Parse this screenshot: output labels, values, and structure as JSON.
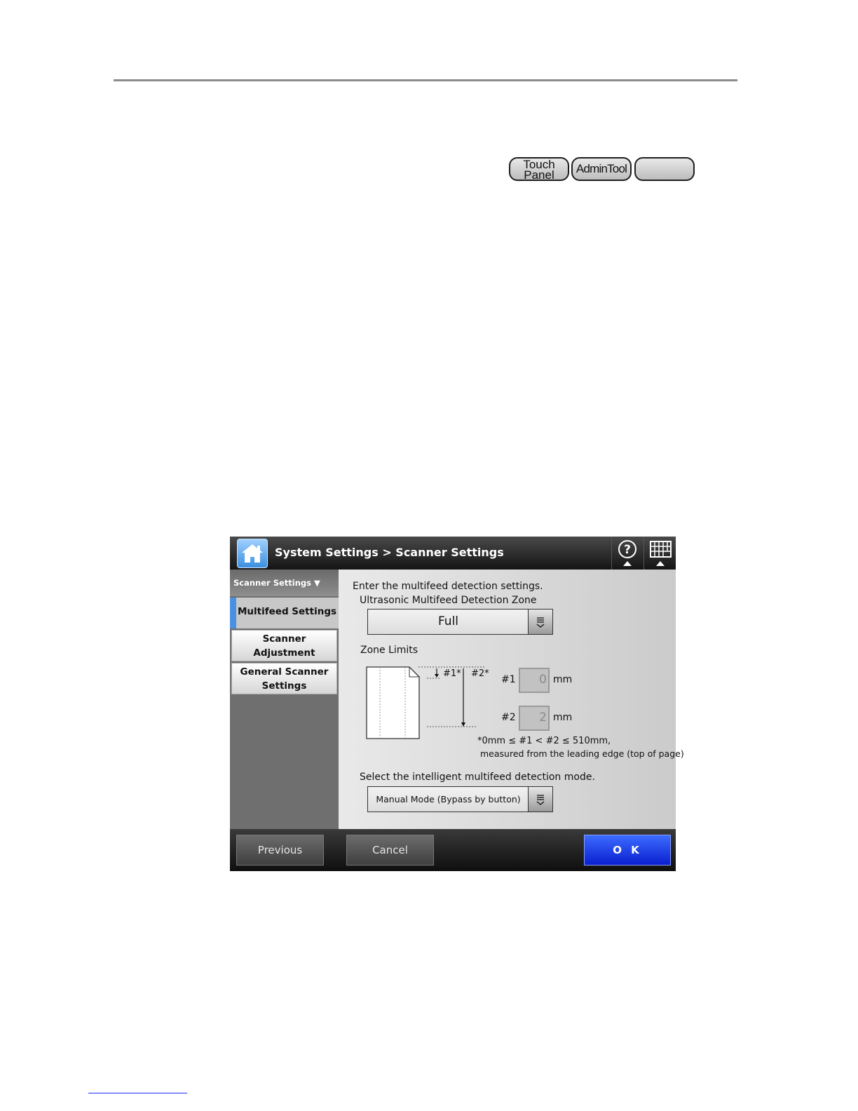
{
  "doc": {
    "badges": {
      "touch_panel": "Touch\nPanel",
      "admin_tool": "AdminTool",
      "blank": ""
    }
  },
  "screen": {
    "breadcrumb": "System Settings > Scanner Settings",
    "icons": {
      "home": "home-icon",
      "help": "help-icon",
      "keyboard": "keyboard-icon"
    },
    "sidebar": {
      "header": "Scanner Settings ▼",
      "active_item": "Multifeed Settings",
      "items": [
        "Scanner\nAdjustment",
        "General Scanner\nSettings"
      ]
    },
    "content": {
      "intro": "Enter the multifeed detection settings.",
      "zone_label": "Ultrasonic Multifeed Detection Zone",
      "zone_value": "Full",
      "zone_limits_label": "Zone Limits",
      "diagram": {
        "label1": "#1*",
        "label2": "#2*"
      },
      "limit1": {
        "label": "#1",
        "value": "0",
        "unit": "mm"
      },
      "limit2": {
        "label": "#2",
        "value": "2",
        "unit": "mm"
      },
      "note_line1": "*0mm ≤ #1 < #2 ≤ 510mm,",
      "note_line2": "measured from the leading edge (top of page)",
      "mode_label": "Select the intelligent multifeed detection mode.",
      "mode_value": "Manual Mode (Bypass by button)"
    },
    "buttons": {
      "previous": "Previous",
      "cancel": "Cancel",
      "ok": "O K"
    },
    "colors": {
      "ok_button": "#1a35e8",
      "active_indicator": "#4a90e2",
      "home_button": "#5aa8f0"
    }
  }
}
